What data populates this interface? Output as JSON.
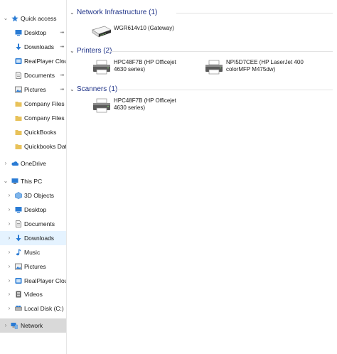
{
  "nav": {
    "quick_access": {
      "label": "Quick access",
      "icon": "star-icon"
    },
    "quick_items": [
      {
        "label": "Desktop",
        "icon": "desktop-icon",
        "pinned": true
      },
      {
        "label": "Downloads",
        "icon": "downloads-icon",
        "pinned": true
      },
      {
        "label": "RealPlayer Clou",
        "icon": "realplayer-icon",
        "pinned": true
      },
      {
        "label": "Documents",
        "icon": "documents-icon",
        "pinned": true
      },
      {
        "label": "Pictures",
        "icon": "pictures-icon",
        "pinned": true
      },
      {
        "label": "Company Files",
        "icon": "folder-icon",
        "pinned": false
      },
      {
        "label": "Company Files",
        "icon": "folder-icon",
        "pinned": false
      },
      {
        "label": "QuickBooks",
        "icon": "folder-icon",
        "pinned": false
      },
      {
        "label": "Quickbooks Data",
        "icon": "folder-icon",
        "pinned": false
      }
    ],
    "onedrive": {
      "label": "OneDrive",
      "icon": "onedrive-icon"
    },
    "this_pc": {
      "label": "This PC",
      "icon": "computer-icon"
    },
    "pc_items": [
      {
        "label": "3D Objects",
        "icon": "3d-objects-icon"
      },
      {
        "label": "Desktop",
        "icon": "desktop-icon"
      },
      {
        "label": "Documents",
        "icon": "documents-icon"
      },
      {
        "label": "Downloads",
        "icon": "downloads-icon"
      },
      {
        "label": "Music",
        "icon": "music-icon"
      },
      {
        "label": "Pictures",
        "icon": "pictures-icon"
      },
      {
        "label": "RealPlayer Cloud",
        "icon": "realplayer-icon"
      },
      {
        "label": "Videos",
        "icon": "videos-icon"
      },
      {
        "label": "Local Disk (C:)",
        "icon": "drive-icon"
      }
    ],
    "network": {
      "label": "Network",
      "icon": "network-icon"
    }
  },
  "content": {
    "sections": [
      {
        "title": "Network Infrastructure (1)",
        "devices": [
          {
            "name": "WGR614v10 (Gateway)",
            "icon": "router-icon"
          }
        ]
      },
      {
        "title": "Printers (2)",
        "devices": [
          {
            "name": "HPC48F7B (HP Officejet 4630 series)",
            "icon": "printer-icon"
          },
          {
            "name": "NPI5D7CEE (HP LaserJet 400 colorMFP M475dw)",
            "icon": "printer-icon"
          }
        ]
      },
      {
        "title": "Scanners (1)",
        "devices": [
          {
            "name": "HPC48F7B (HP Officejet 4630 series)",
            "icon": "scanner-icon"
          }
        ]
      }
    ]
  },
  "colors": {
    "accent": "#1e3287",
    "hover": "#e5f3ff",
    "selected": "#d9d9d9",
    "folder": "#e8c25a",
    "blue_icon": "#2a7bd4"
  }
}
